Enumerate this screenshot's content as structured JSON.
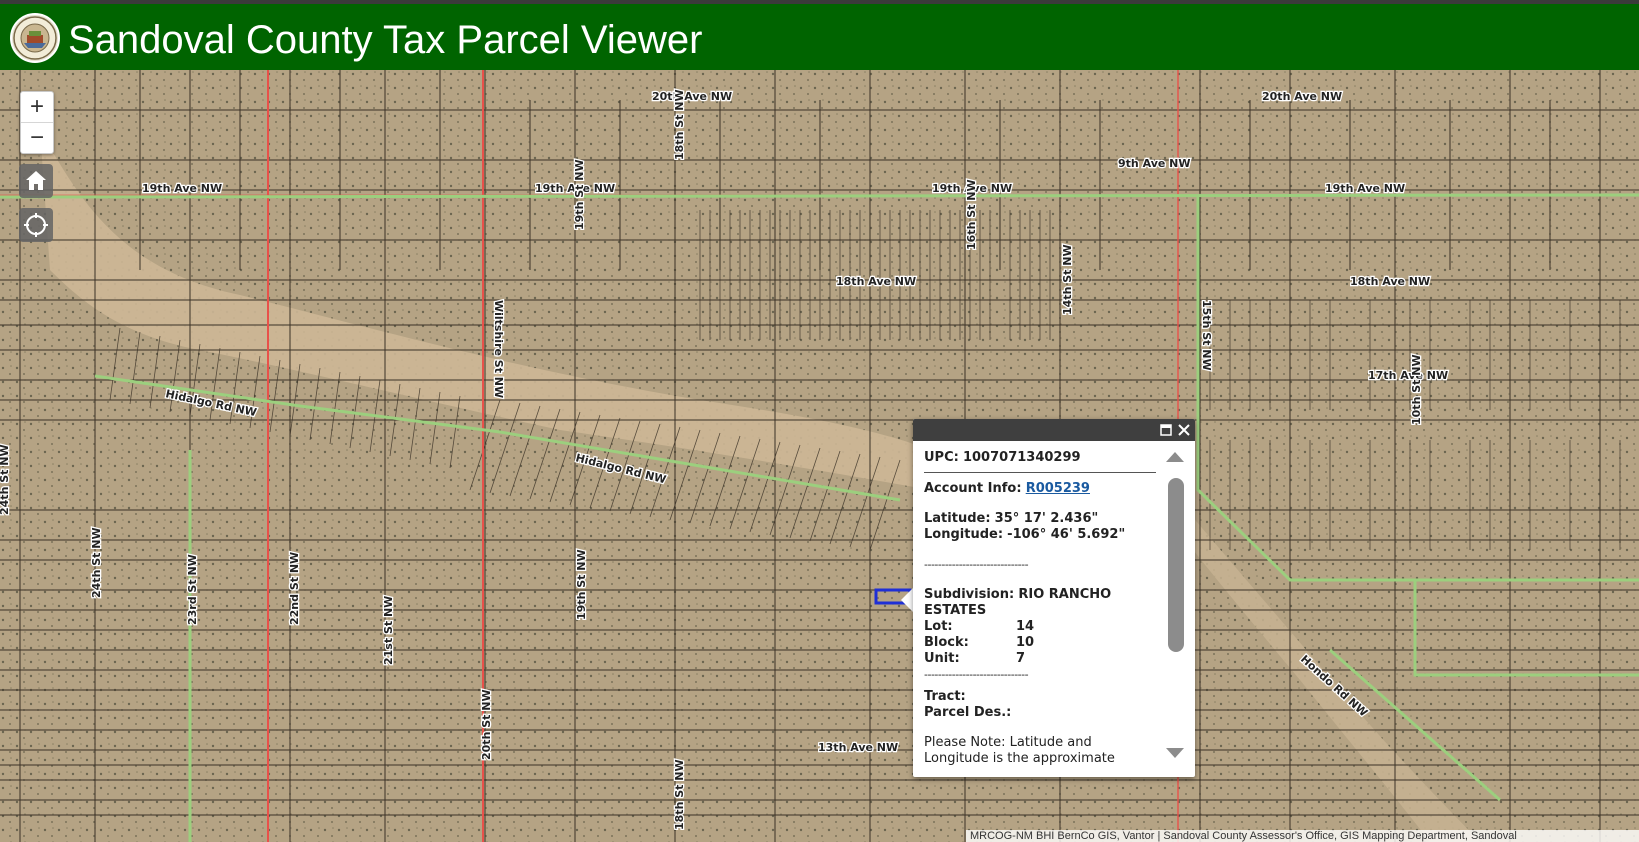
{
  "header": {
    "title": "Sandoval County Tax Parcel Viewer",
    "seal_icon": "county-seal-icon",
    "background": "#006400"
  },
  "map": {
    "controls": {
      "zoom_in": "+",
      "zoom_out": "−",
      "home_icon": "home-icon",
      "locate_icon": "locate-icon"
    },
    "street_labels": {
      "ave20_a": "20th Ave NW",
      "ave20_b": "20th Ave NW",
      "ave9": "9th Ave NW",
      "ave19_a": "19th Ave NW",
      "ave19_b": "19th Ave NW",
      "ave19_c": "19th Ave NW",
      "ave19_d": "19th Ave NW",
      "ave18_a": "18th Ave NW",
      "ave18_b": "18th Ave NW",
      "ave17": "17th Ave NW",
      "ave13": "13th Ave NW",
      "hidalgo_a": "Hidalgo Rd NW",
      "hidalgo_b": "Hidalgo Rd NW",
      "hondo": "Hondo Rd NW",
      "st18": "18th St NW",
      "st19_a": "19th St NW",
      "st19_b": "19th St NW",
      "st16": "16th St NW",
      "st14": "14th St NW",
      "st10": "10th St NW",
      "st24": "24th St NW",
      "st23": "23rd St NW",
      "st22": "22nd St NW",
      "st21": "21st St NW",
      "st20": "20th St NW",
      "st24b": "24th St NW",
      "st_wicomp": "Wiltshire St NW",
      "st15": "15th St NW",
      "st19_c": "19th St NW",
      "st_e": "18th St NW"
    },
    "colors": {
      "road": "#9ccf7e",
      "boundary": "#e8514a",
      "parcel_line": "#3a3126",
      "selected_parcel": "#1f2fd6"
    }
  },
  "popup": {
    "upc_label": "UPC:",
    "upc_value": "1007071340299",
    "account_label": "Account Info:",
    "account_value": "R005239",
    "latitude_label": "Latitude:",
    "latitude_value": "35° 17' 2.436\"",
    "longitude_label": "Longitude:",
    "longitude_value": "-106° 46' 5.692\"",
    "separator": "------------------------------",
    "subdivision_label": "Subdivision:",
    "subdivision_value": "RIO RANCHO ESTATES",
    "lot_label": "Lot:",
    "lot_value": "14",
    "block_label": "Block:",
    "block_value": "10",
    "unit_label": "Unit:",
    "unit_value": "7",
    "tract_label": "Tract:",
    "parcel_des_label": "Parcel Des.:",
    "note": "Please Note: Latitude and Longitude is the approximate center of the",
    "maximize_icon": "maximize-icon",
    "close_icon": "close-icon",
    "scroll_up_icon": "scroll-up-icon",
    "scroll_down_icon": "scroll-down-icon"
  },
  "attribution": "MRCOG-NM BHI BernCo GIS, Vantor | Sandoval County Assessor's Office, GIS Mapping Department, Sandoval"
}
